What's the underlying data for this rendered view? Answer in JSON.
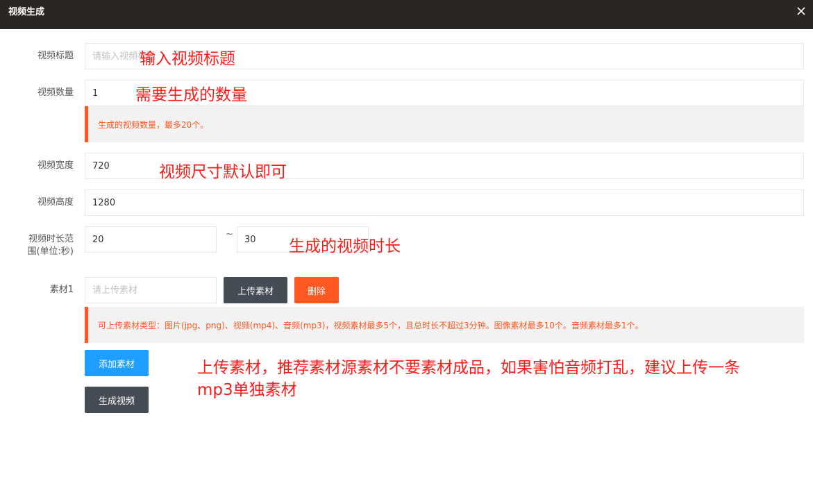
{
  "dialog": {
    "title": "视频生成",
    "close_icon": "close-icon"
  },
  "form": {
    "title_label": "视频标题",
    "title_placeholder": "请输入视频标题",
    "title_value": "",
    "count_label": "视频数量",
    "count_value": "1",
    "count_tip": "生成的视频数量，最多20个。",
    "width_label": "视频宽度",
    "width_value": "720",
    "height_label": "视频高度",
    "height_value": "1280",
    "duration_label": "视频时长范围(单位:秒)",
    "duration_min": "20",
    "duration_separator": "~",
    "duration_max": "30",
    "material_label": "素材1",
    "material_placeholder": "请上传素材",
    "upload_button": "上传素材",
    "delete_button": "删除",
    "material_tip": "可上传素材类型：图片(jpg、png)、视频(mp4)、音频(mp3)，视频素材最多5个，且总时长不超过3分钟。图像素材最多10个。音频素材最多1个。",
    "add_material_button": "添加素材",
    "generate_button": "生成视频"
  },
  "annotations": {
    "title_note": "输入视频标题",
    "count_note": "需要生成的数量",
    "size_note": "视频尺寸默认即可",
    "duration_note": "生成的视频时长",
    "material_note_line1": "上传素材，推荐素材源素材不要素材成品，如果害怕音频打乱，建议上传一条",
    "material_note_line2": "mp3单独素材"
  },
  "colors": {
    "titlebar": "#2b2624",
    "accent_red": "#ff5722",
    "button_dark": "#454c56",
    "button_blue": "#1e9fff",
    "annotation": "#ff1a1a"
  }
}
